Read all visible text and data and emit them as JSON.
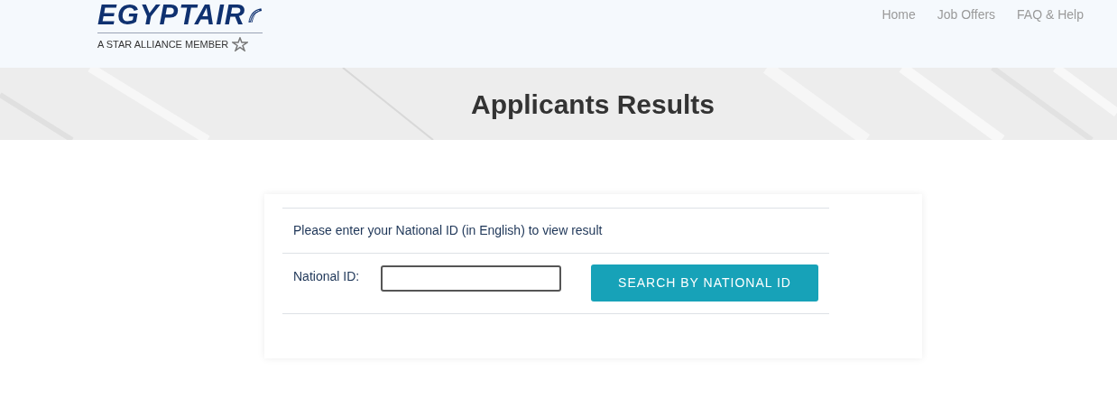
{
  "header": {
    "logo": {
      "brand": "EGYPTAIR",
      "tagline": "A STAR ALLIANCE MEMBER"
    },
    "nav": [
      {
        "label": "Home"
      },
      {
        "label": "Job Offers"
      },
      {
        "label": "FAQ & Help"
      }
    ]
  },
  "banner": {
    "title": "Applicants Results"
  },
  "form": {
    "instruction": "Please enter your National ID (in English) to view result",
    "field_label": "National ID:",
    "button": "SEARCH BY NATIONAL ID"
  }
}
